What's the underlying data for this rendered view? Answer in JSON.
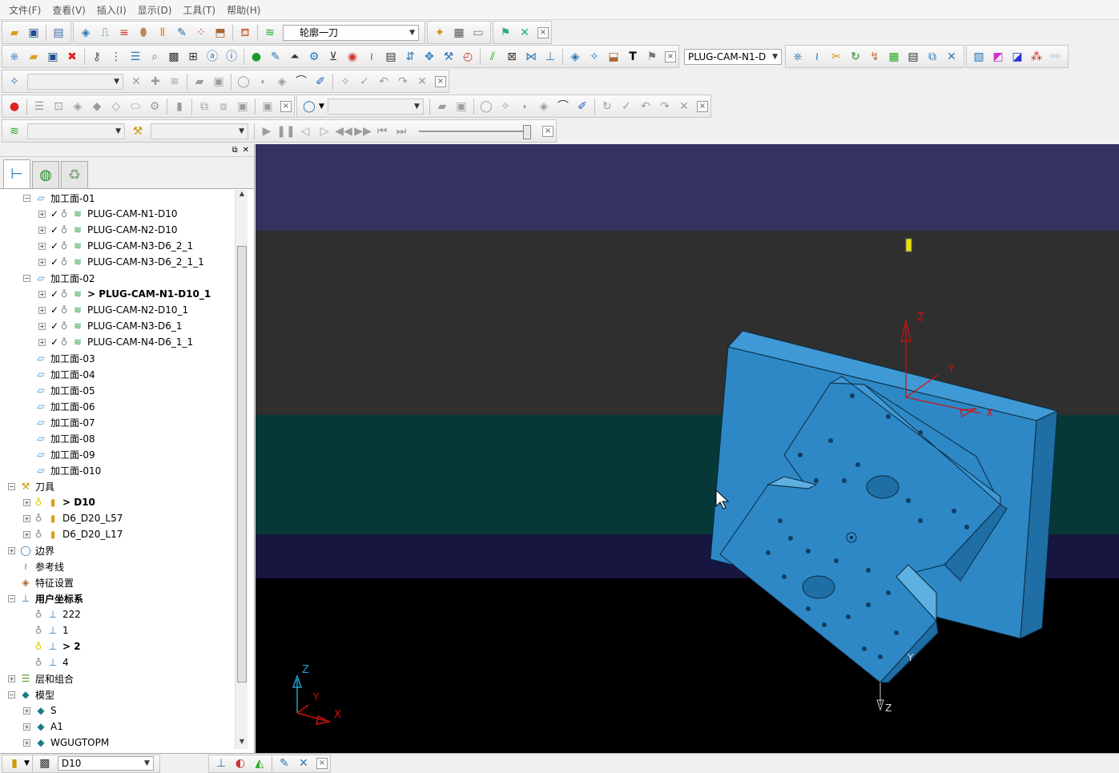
{
  "menu": [
    "文件(F)",
    "查看(V)",
    "插入(I)",
    "显示(D)",
    "工具(T)",
    "帮助(H)"
  ],
  "toolbar1": {
    "strategy_combo": "轮廓一刀"
  },
  "toolbar2": {
    "toolpath_combo": "PLUG-CAM-N1-D"
  },
  "explorer": {
    "tree": [
      {
        "indent": 1,
        "expand": "-",
        "icon": "folder-icon",
        "label": "加工面-01",
        "bold": false
      },
      {
        "indent": 2,
        "expand": "+",
        "check": true,
        "icon": "toolpath-icon",
        "label": "PLUG-CAM-N1-D10",
        "bold": false
      },
      {
        "indent": 2,
        "expand": "+",
        "check": true,
        "icon": "toolpath-icon",
        "label": "PLUG-CAM-N2-D10",
        "bold": false
      },
      {
        "indent": 2,
        "expand": "+",
        "check": true,
        "icon": "toolpath-icon",
        "label": "PLUG-CAM-N3-D6_2_1",
        "bold": false
      },
      {
        "indent": 2,
        "expand": "+",
        "check": true,
        "icon": "toolpath-icon",
        "label": "PLUG-CAM-N3-D6_2_1_1",
        "bold": false
      },
      {
        "indent": 1,
        "expand": "-",
        "icon": "folder-icon",
        "label": "加工面-02",
        "bold": false
      },
      {
        "indent": 2,
        "expand": "+",
        "check": true,
        "icon": "toolpath-icon",
        "label": "> PLUG-CAM-N1-D10_1",
        "bold": true
      },
      {
        "indent": 2,
        "expand": "+",
        "check": true,
        "icon": "toolpath-icon",
        "label": "PLUG-CAM-N2-D10_1",
        "bold": false
      },
      {
        "indent": 2,
        "expand": "+",
        "check": true,
        "icon": "toolpath-icon",
        "label": "PLUG-CAM-N3-D6_1",
        "bold": false
      },
      {
        "indent": 2,
        "expand": "+",
        "check": true,
        "icon": "toolpath-icon",
        "label": "PLUG-CAM-N4-D6_1_1",
        "bold": false
      },
      {
        "indent": 1,
        "expand": "",
        "icon": "folder-icon",
        "label": "加工面-03",
        "bold": false
      },
      {
        "indent": 1,
        "expand": "",
        "icon": "folder-icon",
        "label": "加工面-04",
        "bold": false
      },
      {
        "indent": 1,
        "expand": "",
        "icon": "folder-icon",
        "label": "加工面-05",
        "bold": false
      },
      {
        "indent": 1,
        "expand": "",
        "icon": "folder-icon",
        "label": "加工面-06",
        "bold": false
      },
      {
        "indent": 1,
        "expand": "",
        "icon": "folder-icon",
        "label": "加工面-07",
        "bold": false
      },
      {
        "indent": 1,
        "expand": "",
        "icon": "folder-icon",
        "label": "加工面-08",
        "bold": false
      },
      {
        "indent": 1,
        "expand": "",
        "icon": "folder-icon",
        "label": "加工面-09",
        "bold": false
      },
      {
        "indent": 1,
        "expand": "",
        "icon": "folder-icon",
        "label": "加工面-010",
        "bold": false
      },
      {
        "indent": 0,
        "expand": "-",
        "icon": "tools-icon",
        "label": "刀具",
        "bold": false
      },
      {
        "indent": 1,
        "expand": "+",
        "icon": "tool-icon",
        "label": "> D10",
        "bold": true
      },
      {
        "indent": 1,
        "expand": "+",
        "icon": "tool-icon",
        "label": "D6_D20_L57",
        "bold": false
      },
      {
        "indent": 1,
        "expand": "+",
        "icon": "tool-icon",
        "label": "D6_D20_L17",
        "bold": false
      },
      {
        "indent": 0,
        "expand": "+",
        "icon": "boundary-icon",
        "label": "边界",
        "bold": false
      },
      {
        "indent": 0,
        "expand": "",
        "icon": "pattern-icon",
        "label": "参考线",
        "bold": false
      },
      {
        "indent": 0,
        "expand": "",
        "icon": "feature-icon",
        "label": "特征设置",
        "bold": false
      },
      {
        "indent": 0,
        "expand": "-",
        "icon": "workplane-icon",
        "label": "用户坐标系",
        "bold": true
      },
      {
        "indent": 1,
        "expand": "",
        "icon": "workplane-icon",
        "label": "222",
        "bold": false
      },
      {
        "indent": 1,
        "expand": "",
        "icon": "workplane-icon",
        "label": "1",
        "bold": false
      },
      {
        "indent": 1,
        "expand": "",
        "icon": "workplane-icon",
        "label": "> 2",
        "bold": true
      },
      {
        "indent": 1,
        "expand": "",
        "icon": "workplane-icon",
        "label": "4",
        "bold": false
      },
      {
        "indent": 0,
        "expand": "+",
        "icon": "layers-icon",
        "label": "层和组合",
        "bold": false
      },
      {
        "indent": 0,
        "expand": "-",
        "icon": "model-icon",
        "label": "模型",
        "bold": false
      },
      {
        "indent": 1,
        "expand": "+",
        "icon": "model-icon",
        "label": "S",
        "bold": false
      },
      {
        "indent": 1,
        "expand": "+",
        "icon": "model-icon",
        "label": "A1",
        "bold": false
      },
      {
        "indent": 1,
        "expand": "+",
        "icon": "model-icon",
        "label": "WGUGTOPM",
        "bold": false
      }
    ]
  },
  "viewport": {
    "axis_labels": {
      "z": "Z",
      "y": "Y",
      "x": "X"
    },
    "band_colors": [
      "#34325f",
      "#2f2f2f",
      "#053837",
      "#171640",
      "#000000"
    ],
    "part_color": "#2e88c6"
  },
  "statusbar": {
    "tool_combo": "D10"
  }
}
